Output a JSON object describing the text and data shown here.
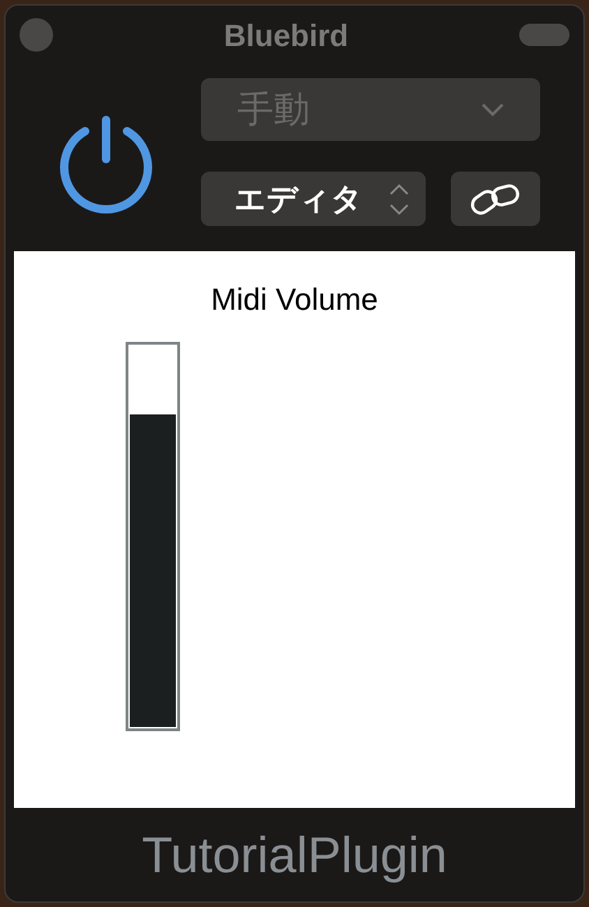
{
  "window": {
    "title": "Bluebird"
  },
  "power": {
    "on": true
  },
  "preset": {
    "value": "手動",
    "disabled": true
  },
  "view": {
    "value": "エディタ"
  },
  "panel": {
    "title": "Midi Volume",
    "meter": {
      "level": 0.82
    }
  },
  "footer": "TutorialPlugin"
}
